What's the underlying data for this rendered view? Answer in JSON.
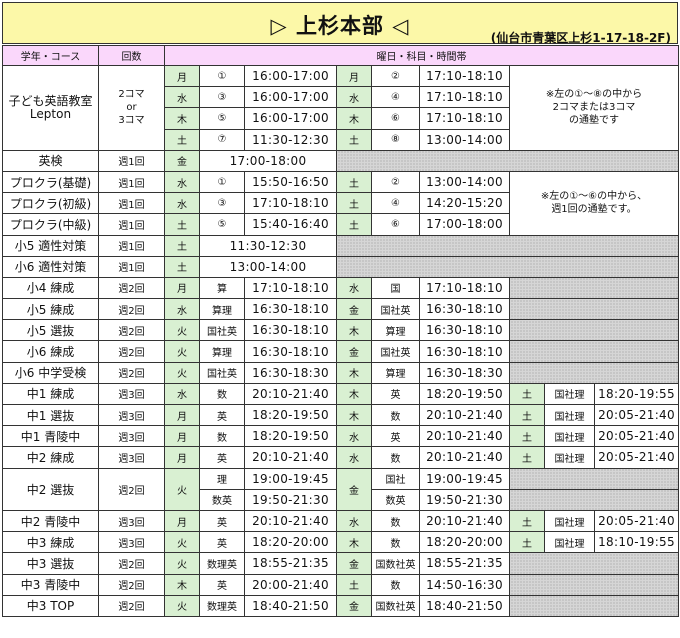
{
  "title": "▷ 上杉本部 ◁",
  "address": "(仙台市青葉区上杉1-17-18-2F)",
  "headers": {
    "course": "学年・コース",
    "count": "回数",
    "schedule": "曜日・科目・時間帯"
  },
  "kids": {
    "course": [
      "子ども英語教室",
      "Lepton"
    ],
    "count": [
      "2コマ",
      "or",
      "3コマ"
    ],
    "note": [
      "※左の①～⑧の中から",
      "2コマまたは3コマ",
      "の通塾です"
    ],
    "rows": [
      [
        "月",
        "①",
        "16:00-17:00",
        "月",
        "②",
        "17:10-18:10"
      ],
      [
        "水",
        "③",
        "16:00-17:00",
        "水",
        "④",
        "17:10-18:10"
      ],
      [
        "木",
        "⑤",
        "16:00-17:00",
        "木",
        "⑥",
        "17:10-18:10"
      ],
      [
        "土",
        "⑦",
        "11:30-12:30",
        "土",
        "⑧",
        "13:00-14:00"
      ]
    ]
  },
  "eiken": {
    "course": "英検",
    "count": "週1回",
    "day": "金",
    "time": "17:00-18:00"
  },
  "procla": {
    "note": [
      "※左の①～⑥の中から、",
      "週1回の通塾です。"
    ],
    "rows": [
      {
        "course": "プロクラ(基礎)",
        "count": "週1回",
        "cells": [
          "水",
          "①",
          "15:50-16:50",
          "土",
          "②",
          "13:00-14:00"
        ]
      },
      {
        "course": "プロクラ(初級)",
        "count": "週1回",
        "cells": [
          "水",
          "③",
          "17:10-18:10",
          "土",
          "④",
          "14:20-15:20"
        ]
      },
      {
        "course": "プロクラ(中級)",
        "count": "週1回",
        "cells": [
          "土",
          "⑤",
          "15:40-16:40",
          "土",
          "⑥",
          "17:00-18:00"
        ]
      }
    ]
  },
  "aptitude": [
    {
      "course": "小5 適性対策",
      "count": "週1回",
      "day": "土",
      "time": "11:30-12:30"
    },
    {
      "course": "小6 適性対策",
      "count": "週1回",
      "day": "土",
      "time": "13:00-14:00"
    }
  ],
  "two_slot": [
    {
      "course": "小4 練成",
      "count": "週2回",
      "cells": [
        "月",
        "算",
        "17:10-18:10",
        "水",
        "国",
        "17:10-18:10"
      ]
    },
    {
      "course": "小5 練成",
      "count": "週2回",
      "cells": [
        "水",
        "算理",
        "16:30-18:10",
        "金",
        "国社英",
        "16:30-18:10"
      ]
    },
    {
      "course": "小5 選抜",
      "count": "週2回",
      "cells": [
        "火",
        "国社英",
        "16:30-18:10",
        "木",
        "算理",
        "16:30-18:10"
      ]
    },
    {
      "course": "小6 練成",
      "count": "週2回",
      "cells": [
        "火",
        "算理",
        "16:30-18:10",
        "金",
        "国社英",
        "16:30-18:10"
      ]
    },
    {
      "course": "小6 中学受検",
      "count": "週2回",
      "cells": [
        "火",
        "国社英",
        "16:30-18:30",
        "木",
        "算理",
        "16:30-18:30"
      ]
    }
  ],
  "three_slot_a": [
    {
      "course": "中1 練成",
      "count": "週3回",
      "cells": [
        "水",
        "数",
        "20:10-21:40",
        "木",
        "英",
        "18:20-19:50",
        "土",
        "国社理",
        "18:20-19:55"
      ]
    },
    {
      "course": "中1 選抜",
      "count": "週3回",
      "cells": [
        "月",
        "英",
        "18:20-19:50",
        "木",
        "数",
        "20:10-21:40",
        "土",
        "国社理",
        "20:05-21:40"
      ]
    },
    {
      "course": "中1 青陵中",
      "count": "週3回",
      "cells": [
        "月",
        "数",
        "18:20-19:50",
        "水",
        "英",
        "20:10-21:40",
        "土",
        "国社理",
        "20:05-21:40"
      ]
    },
    {
      "course": "中2 練成",
      "count": "週3回",
      "cells": [
        "月",
        "英",
        "20:10-21:40",
        "水",
        "数",
        "20:10-21:40",
        "土",
        "国社理",
        "20:05-21:40"
      ]
    }
  ],
  "chu2_senbatsu": {
    "course": "中2 選抜",
    "count": "週2回",
    "day1": "火",
    "day2": "金",
    "r1": [
      "理",
      "19:00-19:45",
      "国社",
      "19:00-19:45"
    ],
    "r2": [
      "数英",
      "19:50-21:30",
      "数英",
      "19:50-21:30"
    ]
  },
  "three_slot_b": [
    {
      "course": "中2 青陵中",
      "count": "週3回",
      "cells": [
        "月",
        "英",
        "20:10-21:40",
        "水",
        "数",
        "20:10-21:40",
        "土",
        "国社理",
        "20:05-21:40"
      ]
    },
    {
      "course": "中3 練成",
      "count": "週3回",
      "cells": [
        "火",
        "英",
        "18:20-20:00",
        "木",
        "数",
        "18:20-20:00",
        "土",
        "国社理",
        "18:10-19:55"
      ]
    }
  ],
  "chu3_two": [
    {
      "course": "中3 選抜",
      "count": "週2回",
      "cells": [
        "火",
        "数理英",
        "18:55-21:35",
        "金",
        "国数社英",
        "18:55-21:35"
      ]
    },
    {
      "course": "中3 青陵中",
      "count": "週2回",
      "cells": [
        "木",
        "英",
        "20:00-21:40",
        "土",
        "数",
        "14:50-16:30"
      ]
    },
    {
      "course": "中3 TOP",
      "count": "週2回",
      "cells": [
        "火",
        "数理英",
        "18:40-21:50",
        "金",
        "国数社英",
        "18:40-21:50"
      ]
    }
  ]
}
